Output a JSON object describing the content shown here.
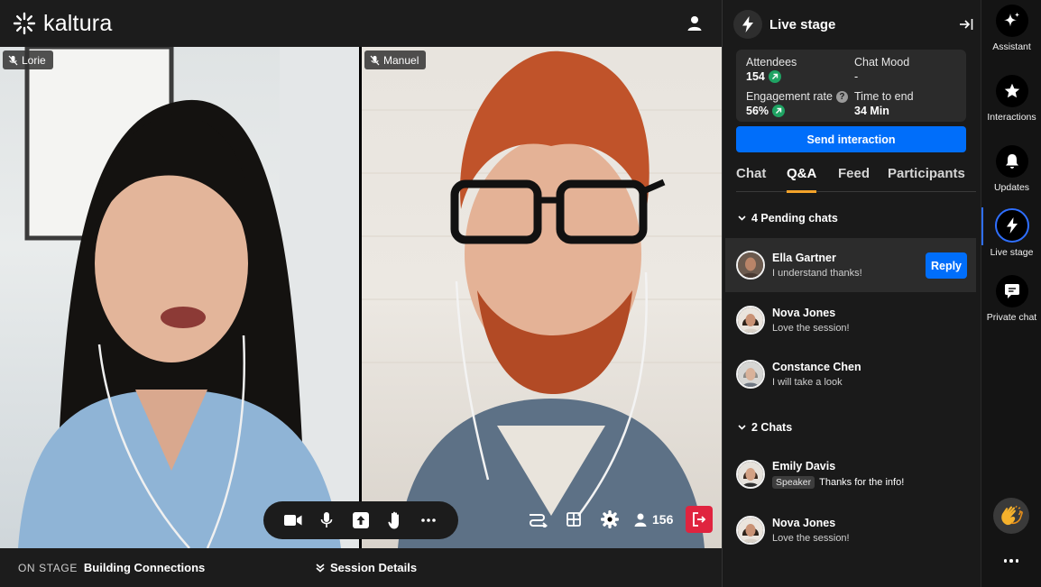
{
  "topbar": {
    "logo_text": "kaltura",
    "user_icon": "user-icon"
  },
  "video": {
    "participants": [
      {
        "name": "Lorie",
        "muted": true
      },
      {
        "name": "Manuel",
        "muted": true
      }
    ],
    "controls": [
      "camera-icon",
      "microphone-icon",
      "share-screen-icon",
      "raise-hand-icon",
      "more-icon"
    ],
    "right_controls": [
      "layout-switch-icon",
      "grid-icon",
      "settings-icon",
      "people-icon",
      "leave-icon"
    ],
    "participant_count": "156"
  },
  "bottombar": {
    "on_stage_label": "ON STAGE",
    "on_stage_title": "Building Connections",
    "session_details": "Session Details"
  },
  "panel": {
    "title": "Live stage",
    "stats": {
      "attendees_label": "Attendees",
      "attendees_value": "154",
      "chat_mood_label": "Chat Mood",
      "chat_mood_value": "-",
      "engagement_label": "Engagement rate",
      "engagement_value": "56%",
      "time_label": "Time to end",
      "time_value": "34 Min"
    },
    "send_button": "Send interaction",
    "tabs": [
      "Chat",
      "Q&A",
      "Feed",
      "Participants"
    ],
    "active_tab": "Q&A",
    "pending_header": "4 Pending chats",
    "pending": [
      {
        "name": "Ella Gartner",
        "message": "I understand thanks!",
        "reply_label": "Reply"
      },
      {
        "name": "Nova Jones",
        "message": "Love the session!"
      },
      {
        "name": "Constance Chen",
        "message": "I will take a look"
      }
    ],
    "chats_header": "2 Chats",
    "chats": [
      {
        "name": "Emily Davis",
        "badge": "Speaker",
        "message": "Thanks for the info!"
      },
      {
        "name": "Nova Jones",
        "message": "Love the session!"
      }
    ]
  },
  "rail": {
    "items": [
      {
        "label": "Assistant",
        "icon": "sparkle-icon"
      },
      {
        "label": "Interactions",
        "icon": "star-icon"
      },
      {
        "label": "Updates",
        "icon": "bell-icon"
      },
      {
        "label": "Live stage",
        "icon": "lightning-icon",
        "active": true
      },
      {
        "label": "Private chat",
        "icon": "chat-bubble-icon"
      }
    ],
    "reaction_icon": "clapping-hands-icon",
    "more_icon": "more-icon"
  },
  "colors": {
    "accent_blue": "#006efa",
    "tab_underline": "#f4a32a",
    "leave_red": "#e0243f",
    "trend_green": "#1fa363"
  }
}
